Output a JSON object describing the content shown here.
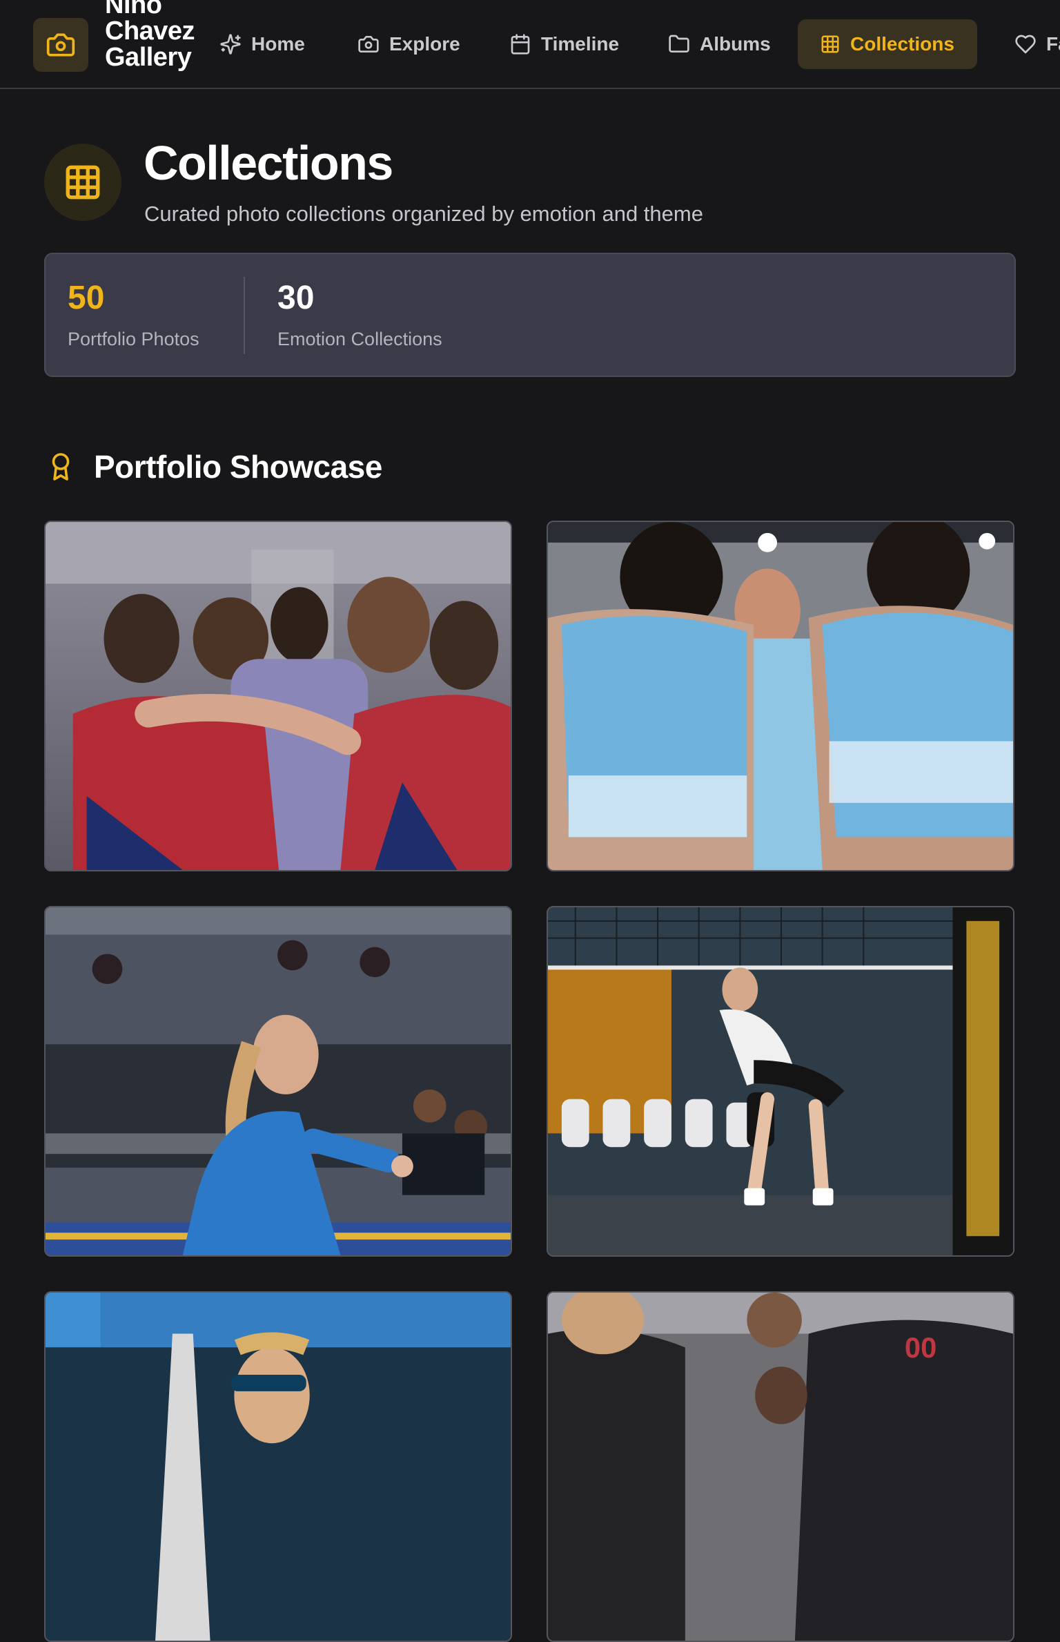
{
  "brand": {
    "name_lines": [
      "Nino",
      "Chavez",
      "Gallery"
    ],
    "logo_icon": "camera-icon"
  },
  "nav": {
    "items": [
      {
        "label": "Home",
        "icon": "sparkles-icon",
        "active": false
      },
      {
        "label": "Explore",
        "icon": "camera-icon",
        "active": false
      },
      {
        "label": "Timeline",
        "icon": "calendar-icon",
        "active": false
      },
      {
        "label": "Albums",
        "icon": "folder-icon",
        "active": false
      },
      {
        "label": "Collections",
        "icon": "grid-icon",
        "active": true
      },
      {
        "label": "Fa",
        "icon": "heart-icon",
        "active": false
      }
    ]
  },
  "page": {
    "icon": "grid-icon",
    "title": "Collections",
    "subtitle": "Curated photo collections organized by emotion and theme"
  },
  "stats": [
    {
      "value": "50",
      "label": "Portfolio Photos",
      "color": "#f0b51a"
    },
    {
      "value": "30",
      "label": "Emotion Collections",
      "color": "#ffffff"
    }
  ],
  "section": {
    "icon": "award-icon",
    "title": "Portfolio Showcase"
  },
  "photos": [
    {
      "subject": "team-huddle-red-jerseys",
      "caption": ""
    },
    {
      "subject": "team-huddle-light-blue-jerseys",
      "caption": ""
    },
    {
      "subject": "player-blue-jersey-reacting",
      "caption": ""
    },
    {
      "subject": "player-ready-stance-milwaukee",
      "caption": ""
    },
    {
      "subject": "player-sunglasses-outdoor",
      "caption": ""
    },
    {
      "subject": "players-black-red-jerseys",
      "caption": ""
    }
  ],
  "colors": {
    "accent": "#f0b51a",
    "background": "#17171a",
    "card": "#3a3a48"
  }
}
